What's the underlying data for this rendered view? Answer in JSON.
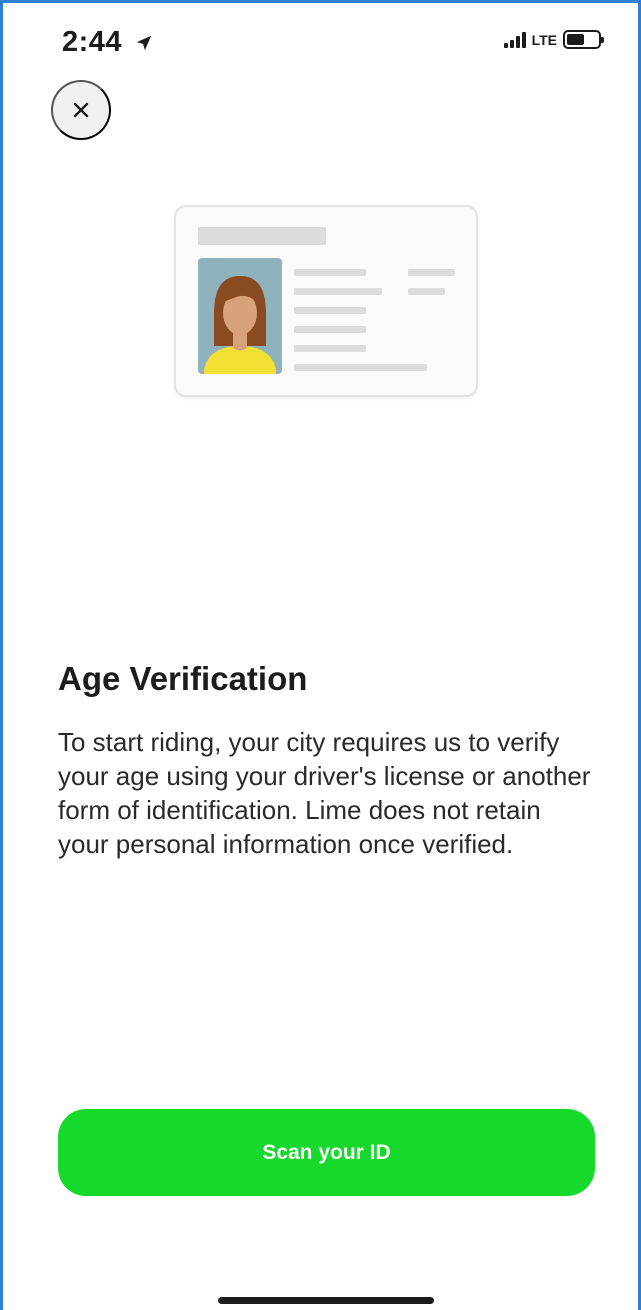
{
  "status_bar": {
    "time": "2:44",
    "network": "LTE",
    "battery_level": 0.55
  },
  "header": {
    "close_icon": "close-icon"
  },
  "illustration": {
    "icon": "id-card-illustration"
  },
  "content": {
    "title": "Age Verification",
    "description": "To start riding, your city requires us to verify your age using your driver's license or another form of identification. Lime does not retain your personal information once verified."
  },
  "actions": {
    "primary_label": "Scan your ID"
  },
  "colors": {
    "accent": "#17d92c",
    "frame_border": "#2f7fd6"
  }
}
